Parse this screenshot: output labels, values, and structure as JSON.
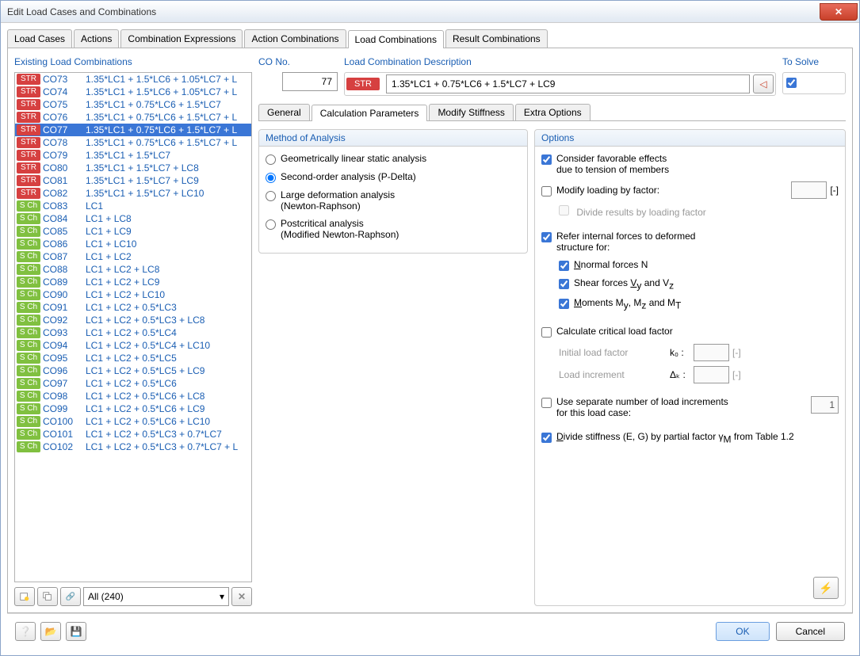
{
  "window": {
    "title": "Edit Load Cases and Combinations"
  },
  "mainTabs": [
    "Load Cases",
    "Actions",
    "Combination Expressions",
    "Action Combinations",
    "Load Combinations",
    "Result Combinations"
  ],
  "activeMainTab": 4,
  "leftPanel": {
    "title": "Existing Load Combinations",
    "filterSelect": "All (240)",
    "items": [
      {
        "badge": "STR",
        "id": "CO73",
        "expr": "1.35*LC1 + 1.5*LC6 + 1.05*LC7 + L"
      },
      {
        "badge": "STR",
        "id": "CO74",
        "expr": "1.35*LC1 + 1.5*LC6 + 1.05*LC7 + L"
      },
      {
        "badge": "STR",
        "id": "CO75",
        "expr": "1.35*LC1 + 0.75*LC6 + 1.5*LC7"
      },
      {
        "badge": "STR",
        "id": "CO76",
        "expr": "1.35*LC1 + 0.75*LC6 + 1.5*LC7 + L"
      },
      {
        "badge": "STR",
        "id": "CO77",
        "expr": "1.35*LC1 + 0.75*LC6 + 1.5*LC7 + L",
        "selected": true
      },
      {
        "badge": "STR",
        "id": "CO78",
        "expr": "1.35*LC1 + 0.75*LC6 + 1.5*LC7 + L"
      },
      {
        "badge": "STR",
        "id": "CO79",
        "expr": "1.35*LC1 + 1.5*LC7"
      },
      {
        "badge": "STR",
        "id": "CO80",
        "expr": "1.35*LC1 + 1.5*LC7 + LC8"
      },
      {
        "badge": "STR",
        "id": "CO81",
        "expr": "1.35*LC1 + 1.5*LC7 + LC9"
      },
      {
        "badge": "STR",
        "id": "CO82",
        "expr": "1.35*LC1 + 1.5*LC7 + LC10"
      },
      {
        "badge": "S Ch",
        "id": "CO83",
        "expr": "LC1"
      },
      {
        "badge": "S Ch",
        "id": "CO84",
        "expr": "LC1 + LC8"
      },
      {
        "badge": "S Ch",
        "id": "CO85",
        "expr": "LC1 + LC9"
      },
      {
        "badge": "S Ch",
        "id": "CO86",
        "expr": "LC1 + LC10"
      },
      {
        "badge": "S Ch",
        "id": "CO87",
        "expr": "LC1 + LC2"
      },
      {
        "badge": "S Ch",
        "id": "CO88",
        "expr": "LC1 + LC2 + LC8"
      },
      {
        "badge": "S Ch",
        "id": "CO89",
        "expr": "LC1 + LC2 + LC9"
      },
      {
        "badge": "S Ch",
        "id": "CO90",
        "expr": "LC1 + LC2 + LC10"
      },
      {
        "badge": "S Ch",
        "id": "CO91",
        "expr": "LC1 + LC2 + 0.5*LC3"
      },
      {
        "badge": "S Ch",
        "id": "CO92",
        "expr": "LC1 + LC2 + 0.5*LC3 + LC8"
      },
      {
        "badge": "S Ch",
        "id": "CO93",
        "expr": "LC1 + LC2 + 0.5*LC4"
      },
      {
        "badge": "S Ch",
        "id": "CO94",
        "expr": "LC1 + LC2 + 0.5*LC4 + LC10"
      },
      {
        "badge": "S Ch",
        "id": "CO95",
        "expr": "LC1 + LC2 + 0.5*LC5"
      },
      {
        "badge": "S Ch",
        "id": "CO96",
        "expr": "LC1 + LC2 + 0.5*LC5 + LC9"
      },
      {
        "badge": "S Ch",
        "id": "CO97",
        "expr": "LC1 + LC2 + 0.5*LC6"
      },
      {
        "badge": "S Ch",
        "id": "CO98",
        "expr": "LC1 + LC2 + 0.5*LC6 + LC8"
      },
      {
        "badge": "S Ch",
        "id": "CO99",
        "expr": "LC1 + LC2 + 0.5*LC6 + LC9"
      },
      {
        "badge": "S Ch",
        "id": "CO100",
        "expr": "LC1 + LC2 + 0.5*LC6 + LC10"
      },
      {
        "badge": "S Ch",
        "id": "CO101",
        "expr": "LC1 + LC2 + 0.5*LC3 + 0.7*LC7"
      },
      {
        "badge": "S Ch",
        "id": "CO102",
        "expr": "LC1 + LC2 + 0.5*LC3 + 0.7*LC7 + L"
      }
    ]
  },
  "topFields": {
    "coNoLabel": "CO No.",
    "coNo": "77",
    "descLabel": "Load Combination Description",
    "descBadge": "STR",
    "desc": "1.35*LC1 + 0.75*LC6 + 1.5*LC7 + LC9",
    "toSolveLabel": "To Solve"
  },
  "subTabs": [
    "General",
    "Calculation Parameters",
    "Modify Stiffness",
    "Extra Options"
  ],
  "activeSubTab": 1,
  "methodPanel": {
    "title": "Method of Analysis",
    "opt1": "Geometrically linear static analysis",
    "opt2": "Second-order analysis (P-Delta)",
    "opt3a": "Large deformation analysis",
    "opt3b": "(Newton-Raphson)",
    "opt4a": "Postcritical analysis",
    "opt4b": "(Modified Newton-Raphson)"
  },
  "optionsPanel": {
    "title": "Options",
    "favorable1": "Consider favorable effects",
    "favorable2": "due to tension of members",
    "modifyLoading": "Modify loading by factor:",
    "divideResults": "Divide results by loading factor",
    "unitDash": "[-]",
    "referInternal1": "Refer internal forces to deformed",
    "referInternal2": "structure for:",
    "normalForces": "normal forces N",
    "shearForces1": "Shear forces ",
    "shearForces2": " and V",
    "moments1": "oments M",
    "moments2": ", M",
    "moments3": " and M",
    "calcCritical": "Calculate critical load factor",
    "initialLoad": "Initial load factor",
    "loadIncrement": "Load increment",
    "k0": "k₀ :",
    "deltaK": "Δₖ :",
    "useSeparate1": "Use separate number of load increments",
    "useSeparate2": "for this load case:",
    "incValue": "1",
    "divideStiff1": "ivide stiffness (E, G) by partial factor γ",
    "divideStiff2": " from Table 1.2"
  },
  "footer": {
    "ok": "OK",
    "cancel": "Cancel"
  }
}
